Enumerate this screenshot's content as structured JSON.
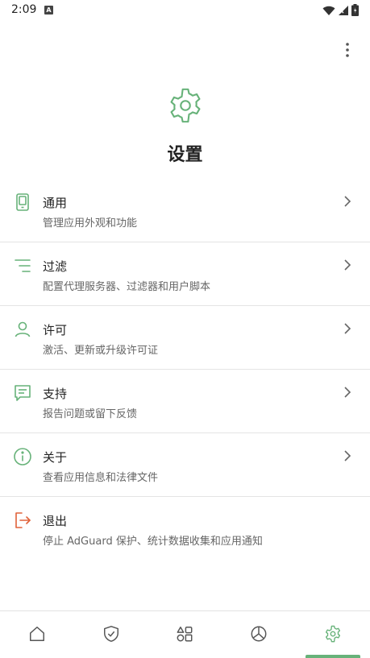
{
  "status_bar": {
    "time": "2:09",
    "notification_icon": "a-icon",
    "icons": [
      "wifi-icon",
      "signal-icon",
      "battery-icon"
    ]
  },
  "header": {
    "icon": "gear-icon",
    "title": "设置",
    "more_icon": "more-vertical-icon"
  },
  "menu": [
    {
      "id": "general",
      "icon": "phone-icon",
      "title": "通用",
      "subtitle": "管理应用外观和功能",
      "color": "#67b279"
    },
    {
      "id": "filtering",
      "icon": "filter-lines-icon",
      "title": "过滤",
      "subtitle": "配置代理服务器、过滤器和用户脚本",
      "color": "#67b279"
    },
    {
      "id": "license",
      "icon": "person-icon",
      "title": "许可",
      "subtitle": "激活、更新或升级许可证",
      "color": "#67b279"
    },
    {
      "id": "support",
      "icon": "chat-icon",
      "title": "支持",
      "subtitle": "报告问题或留下反馈",
      "color": "#67b279"
    },
    {
      "id": "about",
      "icon": "info-icon",
      "title": "关于",
      "subtitle": "查看应用信息和法律文件",
      "color": "#67b279"
    },
    {
      "id": "exit",
      "icon": "logout-icon",
      "title": "退出",
      "subtitle": "停止 AdGuard 保护、统计数据收集和应用通知",
      "color": "#e0623a"
    }
  ],
  "bottom_nav": [
    {
      "icon": "home-icon",
      "active": false
    },
    {
      "icon": "shield-check-icon",
      "active": false
    },
    {
      "icon": "apps-icon",
      "active": false
    },
    {
      "icon": "pie-chart-icon",
      "active": false
    },
    {
      "icon": "gear-icon",
      "active": true
    }
  ],
  "colors": {
    "accent": "#67b279",
    "danger": "#e0623a",
    "text": "#222222",
    "subtext": "#666666"
  }
}
